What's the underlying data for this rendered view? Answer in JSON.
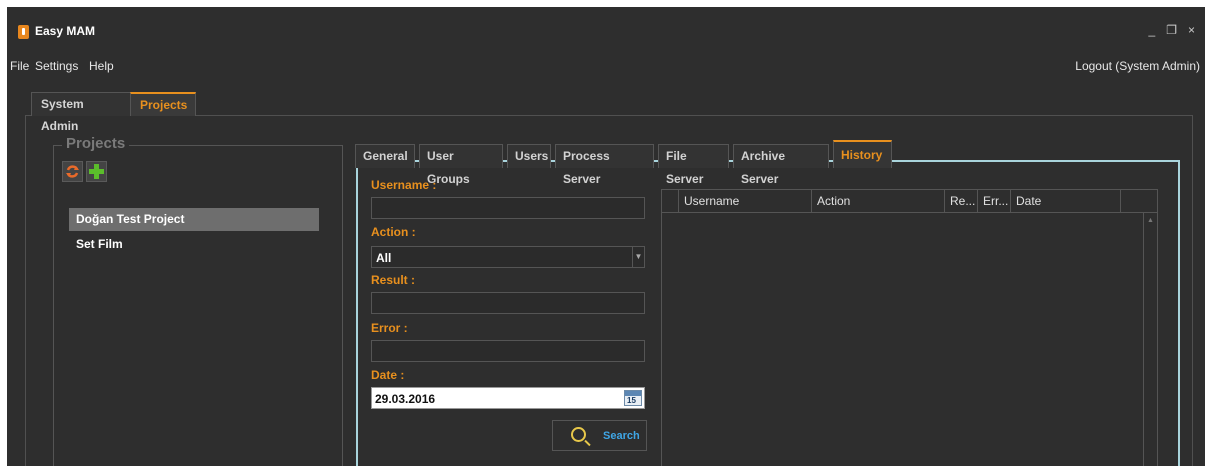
{
  "app": {
    "title": "Easy MAM",
    "window_controls": [
      "_",
      "❐",
      "×"
    ]
  },
  "menu": {
    "items": [
      "File",
      "Settings",
      "Help"
    ],
    "logout": "Logout (System Admin)"
  },
  "top_tabs": [
    {
      "label": "System Admin",
      "active": false
    },
    {
      "label": "Projects",
      "active": true
    }
  ],
  "projects": {
    "group_title": "Projects",
    "items": [
      {
        "name": "Doğan Test Project",
        "selected": true
      },
      {
        "name": "Set Film",
        "selected": false
      }
    ]
  },
  "sub_tabs": [
    {
      "label": "General",
      "active": false
    },
    {
      "label": "User Groups",
      "active": false
    },
    {
      "label": "Users",
      "active": false
    },
    {
      "label": "Process Server",
      "active": false
    },
    {
      "label": "File Server",
      "active": false
    },
    {
      "label": "Archive Server",
      "active": false
    },
    {
      "label": "History",
      "active": true
    }
  ],
  "filters": {
    "username_label": "Username :",
    "username_value": "",
    "action_label": "Action :",
    "action_value": "All",
    "result_label": "Result :",
    "result_value": "",
    "error_label": "Error :",
    "error_value": "",
    "date_label": "Date :",
    "date_value": "29.03.2016",
    "calendar_day": "15",
    "search_label": "Search"
  },
  "grid": {
    "columns": [
      "Username",
      "Action",
      "Re...",
      "Err...",
      "Date"
    ],
    "rows": []
  },
  "colors": {
    "accent": "#e8901e",
    "panel_border": "#a9d4dc",
    "link": "#3fa6e6",
    "background": "#2e2e2e"
  }
}
